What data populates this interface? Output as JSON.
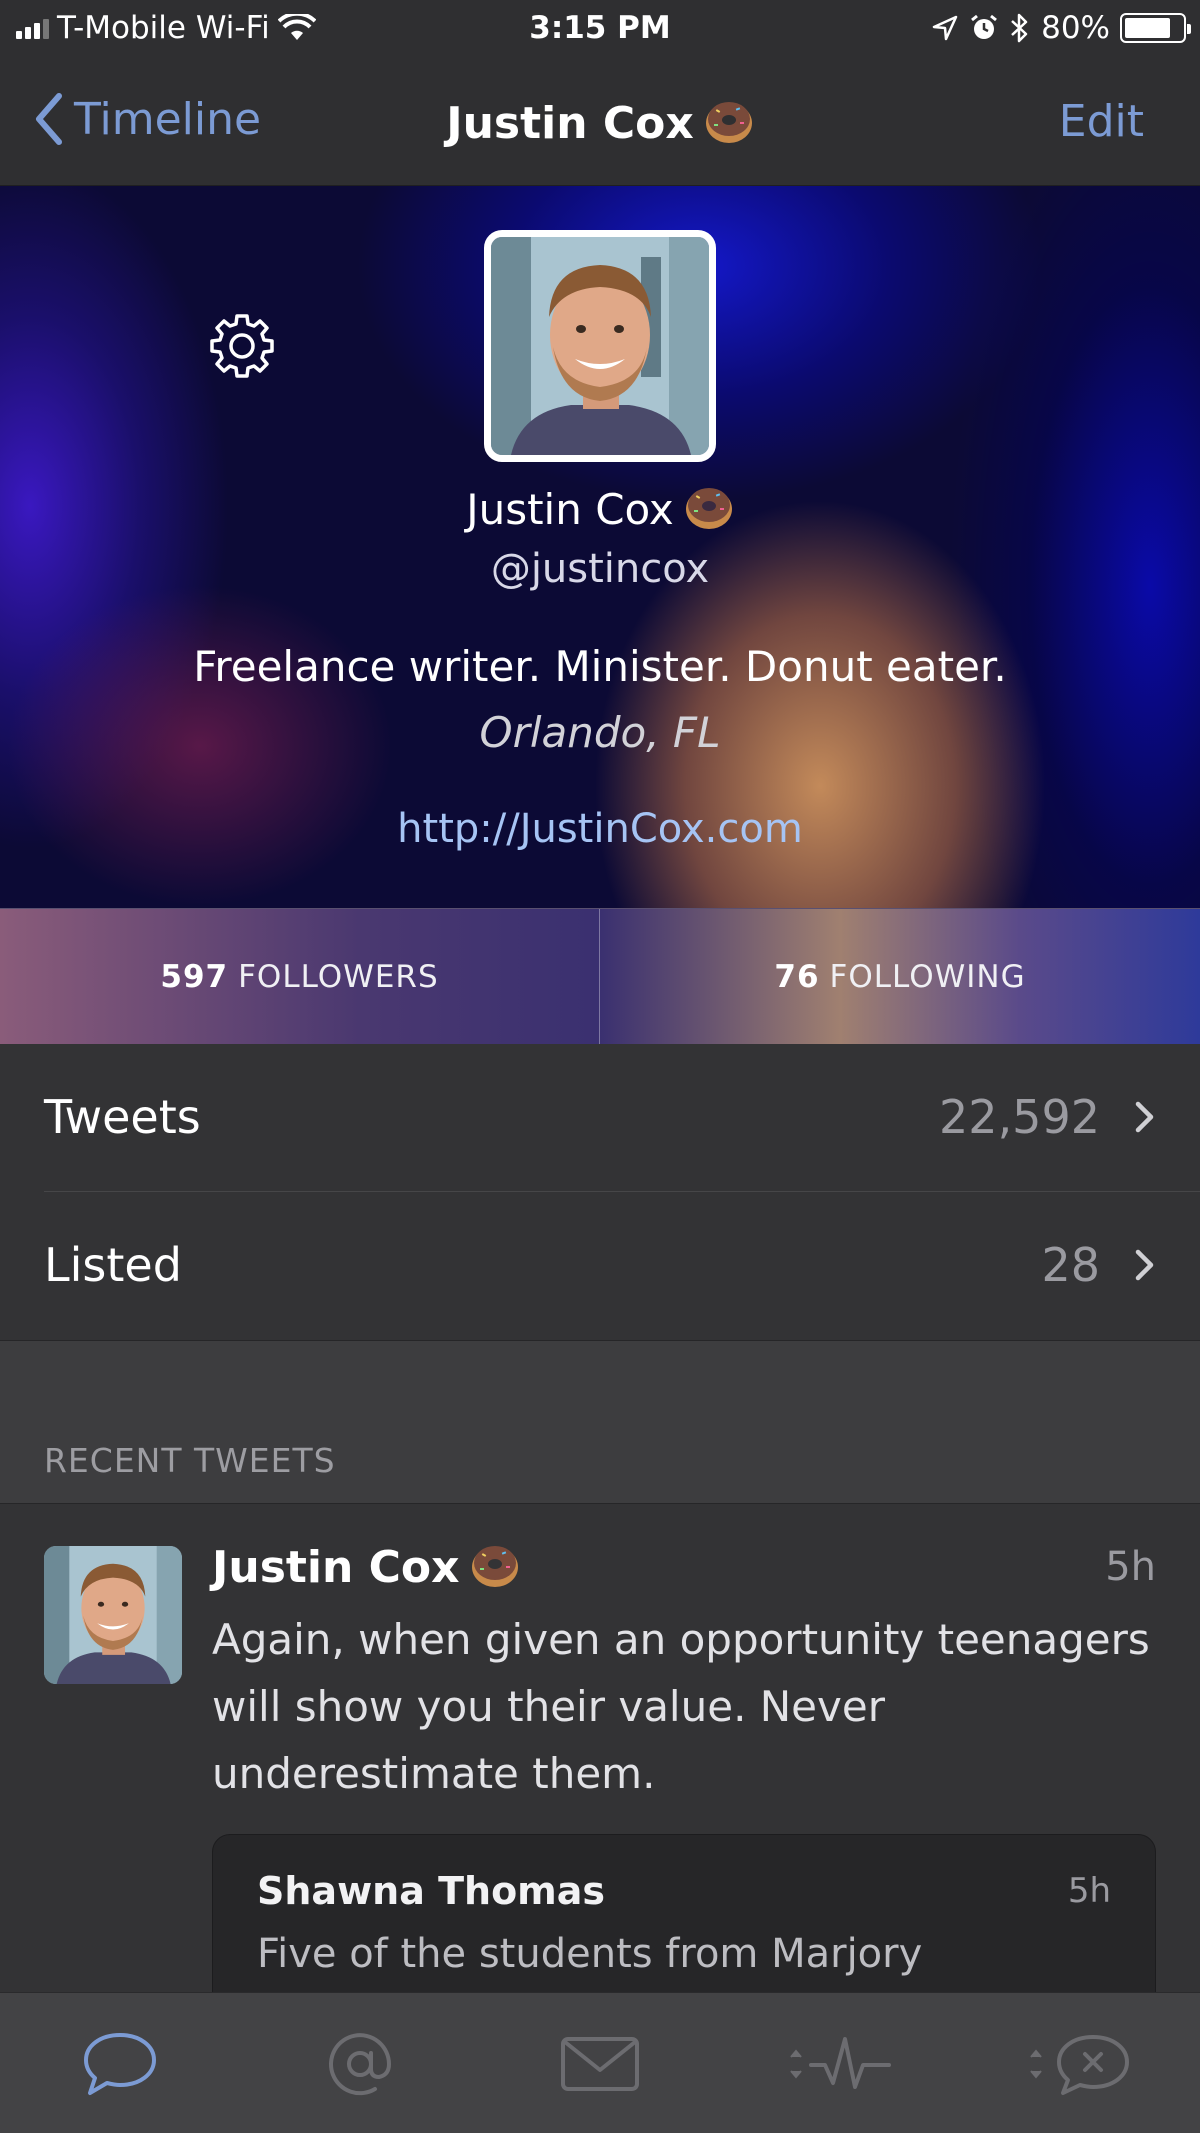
{
  "status_bar": {
    "carrier": "T-Mobile Wi-Fi",
    "time": "3:15 PM",
    "battery": "80%",
    "battery_level": 0.8
  },
  "nav": {
    "back_label": "Timeline",
    "title": "Justin Cox",
    "edit_label": "Edit"
  },
  "profile": {
    "name": "Justin Cox",
    "handle": "@justincox",
    "bio": "Freelance writer. Minister. Donut eater.",
    "location": "Orlando, FL",
    "url": "http://JustinCox.com"
  },
  "stats": {
    "followers_count": "597",
    "followers_label": "FOLLOWERS",
    "following_count": "76",
    "following_label": "FOLLOWING"
  },
  "rows": [
    {
      "label": "Tweets",
      "value": "22,592"
    },
    {
      "label": "Listed",
      "value": "28"
    }
  ],
  "recent_section": {
    "title": "RECENT TWEETS"
  },
  "tweet": {
    "author": "Justin Cox",
    "time": "5h",
    "text": "Again, when given an opportunity teenagers will show you their value. Never underestimate them.",
    "quote": {
      "author": "Shawna Thomas",
      "time": "5h",
      "text": "Five of the students from Marjory"
    }
  },
  "tab_bar": {
    "tabs": [
      {
        "icon": "timeline-bubble-icon",
        "active": true
      },
      {
        "icon": "mentions-at-icon",
        "active": false
      },
      {
        "icon": "messages-envelope-icon",
        "active": false
      },
      {
        "icon": "activity-icon",
        "active": false
      },
      {
        "icon": "mute-filter-icon",
        "active": false
      }
    ]
  },
  "colors": {
    "accent": "#7c9bd4",
    "background": "#333335",
    "link": "#a6c4f4"
  }
}
